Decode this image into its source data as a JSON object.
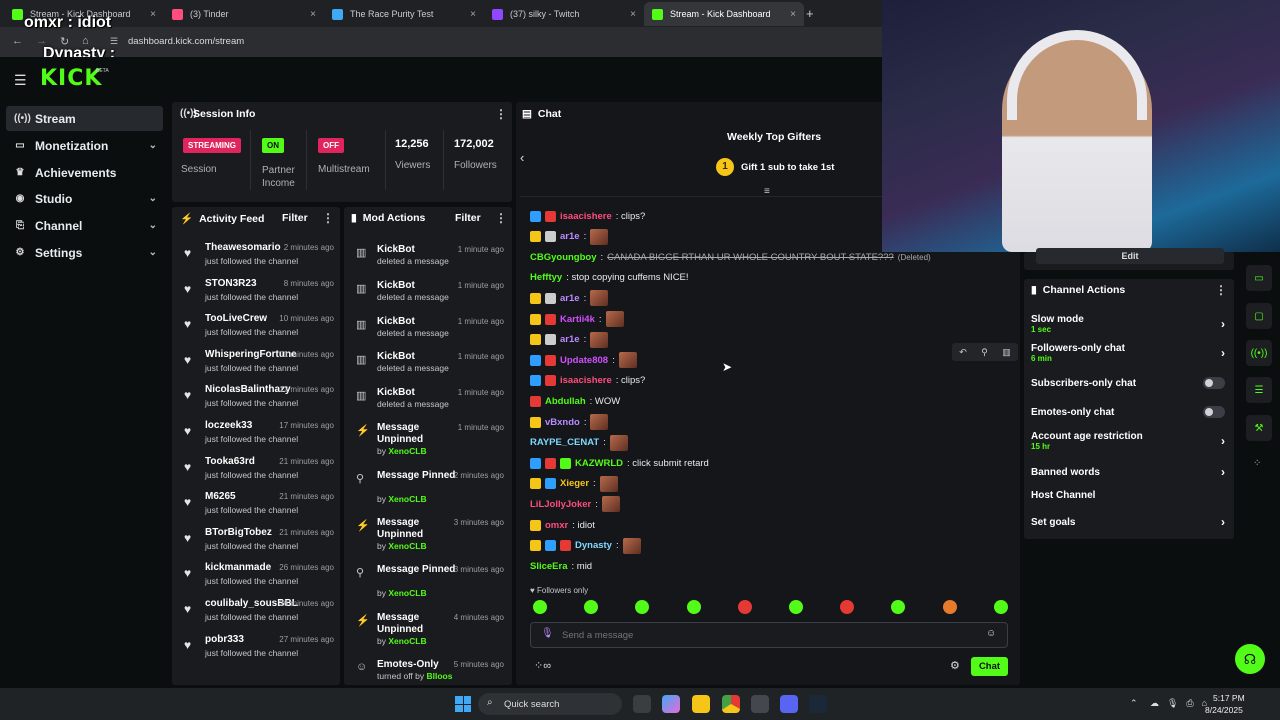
{
  "browser": {
    "tabs": [
      {
        "title": "Stream - Kick Dashboard",
        "active": false
      },
      {
        "title": "(3) Tinder",
        "active": false
      },
      {
        "title": "The Race Purity Test",
        "active": false
      },
      {
        "title": "(37) silky - Twitch",
        "active": false
      },
      {
        "title": "Stream - Kick Dashboard",
        "active": true
      }
    ],
    "url": "dashboard.kick.com/stream"
  },
  "overlay": {
    "line1": "omxr : idiot",
    "line2": "Dynasty :"
  },
  "logo": {
    "text": "KICK",
    "beta": "BETA"
  },
  "sidebar": {
    "items": [
      {
        "label": "Stream",
        "icon": "broadcast-icon"
      },
      {
        "label": "Monetization",
        "icon": "money-icon"
      },
      {
        "label": "Achievements",
        "icon": "trophy-icon"
      },
      {
        "label": "Studio",
        "icon": "studio-icon"
      },
      {
        "label": "Channel",
        "icon": "channel-icon"
      },
      {
        "label": "Settings",
        "icon": "gear-icon"
      }
    ]
  },
  "session": {
    "title": "Session Info",
    "streaming_badge": "STREAMING",
    "session_label": "Session",
    "on_badge": "ON",
    "partner_label": "Partner Income",
    "off_badge": "OFF",
    "multistream_label": "Multistream",
    "viewers_value": "12,256",
    "viewers_label": "Viewers",
    "followers_value": "172,002",
    "followers_label": "Followers"
  },
  "activity": {
    "title": "Activity Feed",
    "filter": "Filter",
    "items": [
      {
        "name": "Theawesomario",
        "time": "2 minutes ago",
        "desc": "just followed the channel"
      },
      {
        "name": "STON3R23",
        "time": "8 minutes ago",
        "desc": "just followed the channel"
      },
      {
        "name": "TooLiveCrew",
        "time": "10 minutes ago",
        "desc": "just followed the channel"
      },
      {
        "name": "WhisperingFortune",
        "time": "11 minutes ago",
        "desc": "just followed the channel"
      },
      {
        "name": "NicolasBalinthazy",
        "time": "12 minutes ago",
        "desc": "just followed the channel"
      },
      {
        "name": "loczeek33",
        "time": "17 minutes ago",
        "desc": "just followed the channel"
      },
      {
        "name": "Tooka63rd",
        "time": "21 minutes ago",
        "desc": "just followed the channel"
      },
      {
        "name": "M6265",
        "time": "21 minutes ago",
        "desc": "just followed the channel"
      },
      {
        "name": "BTorBigTobez",
        "time": "21 minutes ago",
        "desc": "just followed the channel"
      },
      {
        "name": "kickmanmade",
        "time": "26 minutes ago",
        "desc": "just followed the channel"
      },
      {
        "name": "coulibaly_sousBBL",
        "time": "26 minutes ago",
        "desc": "just followed the channel"
      },
      {
        "name": "pobr333",
        "time": "27 minutes ago",
        "desc": "just followed the channel"
      }
    ]
  },
  "mod": {
    "title": "Mod Actions",
    "filter": "Filter",
    "items": [
      {
        "title": "KickBot",
        "time": "1 minute ago",
        "sub": "deleted a message",
        "by": "",
        "icon": "trash-icon"
      },
      {
        "title": "KickBot",
        "time": "1 minute ago",
        "sub": "deleted a message",
        "by": "",
        "icon": "trash-icon"
      },
      {
        "title": "KickBot",
        "time": "1 minute ago",
        "sub": "deleted a message",
        "by": "",
        "icon": "trash-icon"
      },
      {
        "title": "KickBot",
        "time": "1 minute ago",
        "sub": "deleted a message",
        "by": "",
        "icon": "trash-icon"
      },
      {
        "title": "KickBot",
        "time": "1 minute ago",
        "sub": "deleted a message",
        "by": "",
        "icon": "trash-icon"
      },
      {
        "title": "Message Unpinned",
        "time": "1 minute ago",
        "sub": "by ",
        "by": "XenoCLB",
        "icon": "unpin-icon"
      },
      {
        "title": "Message Pinned",
        "time": "2 minutes ago",
        "sub": "by ",
        "by": "XenoCLB",
        "icon": "pin-icon"
      },
      {
        "title": "Message Unpinned",
        "time": "3 minutes ago",
        "sub": "by ",
        "by": "XenoCLB",
        "icon": "unpin-icon"
      },
      {
        "title": "Message Pinned",
        "time": "3 minutes ago",
        "sub": "by ",
        "by": "XenoCLB",
        "icon": "pin-icon"
      },
      {
        "title": "Message Unpinned",
        "time": "4 minutes ago",
        "sub": "by ",
        "by": "XenoCLB",
        "icon": "unpin-icon"
      },
      {
        "title": "Emotes-Only",
        "time": "5 minutes ago",
        "sub": "turned off by ",
        "by": "Blloos",
        "icon": "emote-icon"
      }
    ]
  },
  "chat": {
    "title": "Chat",
    "gifters_title": "Weekly Top Gifters",
    "gift_cta": "Gift 1 sub to take 1st",
    "gift_rank": "1",
    "messages": [
      {
        "user": "isaacishere",
        "color": "#ff4d7e",
        "text": ": clips?",
        "badges": [
          "#2f9fff",
          "#e53935"
        ],
        "emote": false
      },
      {
        "user": "ar1e",
        "color": "#b98cff",
        "text": ":",
        "badges": [
          "#f5c518",
          "#cccccc"
        ],
        "emote": true
      },
      {
        "user": "CBGyoungboy",
        "color": "#53fc18",
        "text": ": ",
        "strike": "CANADA BIGGE RTHAN UR WHOLE COUNTRY BOUT STATE???",
        "deleted": "(Deleted)",
        "badges": [],
        "emote": false
      },
      {
        "user": "Hefftyy",
        "color": "#53fc18",
        "text": ": stop copying cuffems NICE!",
        "badges": [],
        "emote": false
      },
      {
        "user": "ar1e",
        "color": "#b98cff",
        "text": ":",
        "badges": [
          "#f5c518",
          "#cccccc"
        ],
        "emote": true
      },
      {
        "user": "Kartii4k",
        "color": "#d14fff",
        "text": ":",
        "badges": [
          "#f5c518",
          "#e53935"
        ],
        "emote": true
      },
      {
        "user": "ar1e",
        "color": "#b98cff",
        "text": ":",
        "badges": [
          "#f5c518",
          "#cccccc"
        ],
        "emote": true
      },
      {
        "user": "Update808",
        "color": "#d14fff",
        "text": ":",
        "badges": [
          "#2f9fff",
          "#e53935"
        ],
        "emote": true
      },
      {
        "user": "isaacishere",
        "color": "#ff4d7e",
        "text": ": clips?",
        "badges": [
          "#2f9fff",
          "#e53935"
        ],
        "emote": false
      },
      {
        "user": "Abdullah",
        "color": "#53fc18",
        "text": ": WOW",
        "badges": [
          "#e53935"
        ],
        "emote": false
      },
      {
        "user": "vBxndo",
        "color": "#b98cff",
        "text": ":",
        "badges": [
          "#f5c518"
        ],
        "emote": true
      },
      {
        "user": "RAYPE_CENAT",
        "color": "#80d8ff",
        "text": ":",
        "badges": [],
        "emote": true
      },
      {
        "user": "KAZWRLD",
        "color": "#53fc18",
        "text": ": click submit retard",
        "badges": [
          "#2f9fff",
          "#e53935",
          "#53fc18"
        ],
        "emote": false
      },
      {
        "user": "Xieger",
        "color": "#f5c518",
        "text": ":",
        "badges": [
          "#f5c518",
          "#2f9fff"
        ],
        "emote": true
      },
      {
        "user": "LiLJollyJoker",
        "color": "#ff4d7e",
        "text": ":",
        "badges": [],
        "emote": true
      },
      {
        "user": "omxr",
        "color": "#ff4d7e",
        "text": ": idiot",
        "badges": [
          "#f5c518"
        ],
        "emote": false
      },
      {
        "user": "Dynasty",
        "color": "#80d8ff",
        "text": ":",
        "badges": [
          "#f5c518",
          "#2f9fff",
          "#e53935"
        ],
        "emote": true
      },
      {
        "user": "SliceEra",
        "color": "#53fc18",
        "text": ": mid",
        "badges": [],
        "emote": false
      }
    ],
    "followers_only": "Followers only",
    "placeholder": "Send a message",
    "send_label": "Chat"
  },
  "channel_actions": {
    "title": "Channel Actions",
    "edit_label": "Edit",
    "items": [
      {
        "title": "Slow mode",
        "sub": "1 sec",
        "control": "chevron"
      },
      {
        "title": "Followers-only chat",
        "sub": "6 min",
        "control": "chevron"
      },
      {
        "title": "Subscribers-only chat",
        "sub": "",
        "control": "toggle"
      },
      {
        "title": "Emotes-only chat",
        "sub": "",
        "control": "toggle"
      },
      {
        "title": "Account age restriction",
        "sub": "15 hr",
        "control": "chevron"
      },
      {
        "title": "Banned words",
        "sub": "",
        "control": "chevron"
      },
      {
        "title": "Host Channel",
        "sub": "",
        "control": "none"
      },
      {
        "title": "Set goals",
        "sub": "",
        "control": "chevron"
      }
    ]
  },
  "taskbar": {
    "search": "Quick search",
    "time": "5:17 PM",
    "date": "8/24/2025"
  },
  "colors": {
    "accent": "#53fc18",
    "panel": "#191b1f",
    "background": "#0b0e0f",
    "streaming": "#e0245e"
  }
}
